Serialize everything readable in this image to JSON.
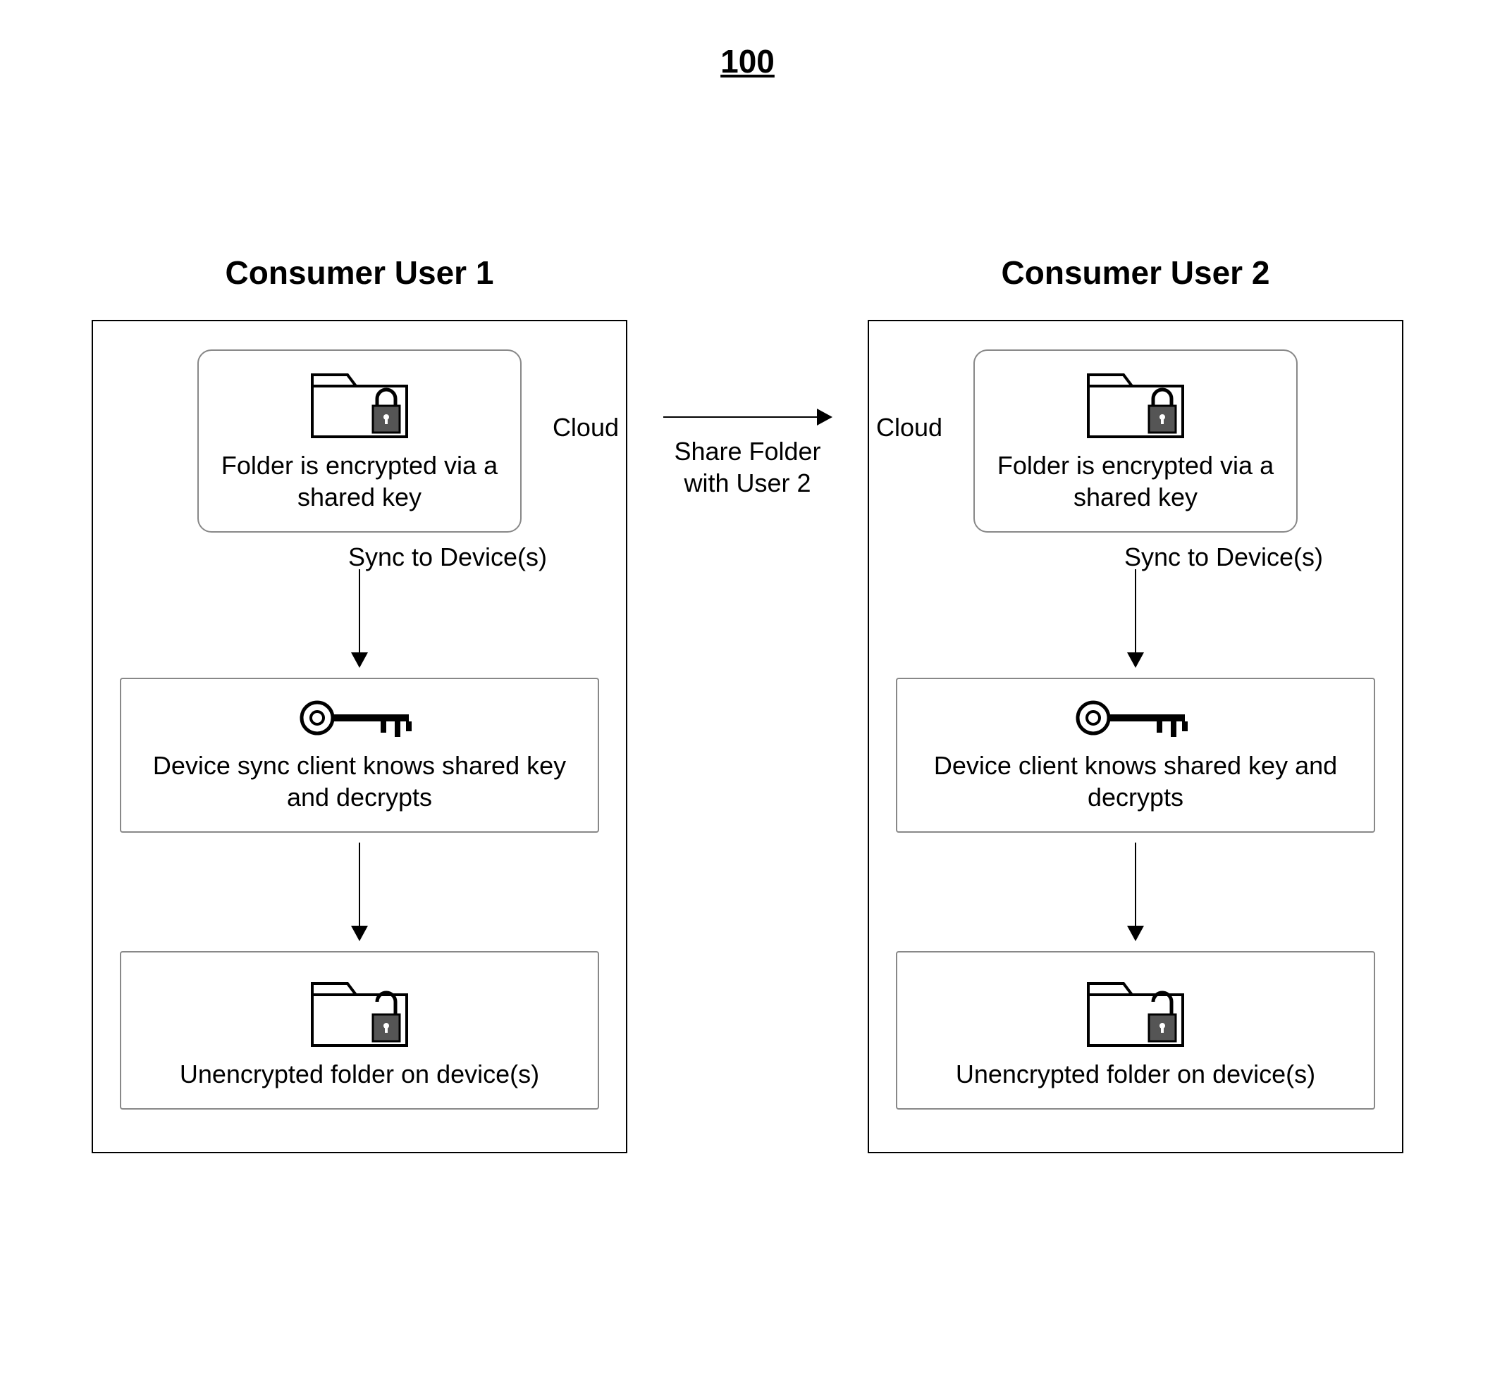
{
  "figure_number": "100",
  "users": {
    "u1": {
      "title": "Consumer User 1",
      "cloudLabel": "Cloud",
      "cloudCard": "Folder is encrypted via a shared key",
      "syncLabel": "Sync to Device(s)",
      "deviceCard": "Device sync client knows shared key and decrypts",
      "resultCard": "Unencrypted folder on device(s)"
    },
    "u2": {
      "title": "Consumer User 2",
      "cloudLabel": "Cloud",
      "cloudCard": "Folder is encrypted via a shared key",
      "syncLabel": "Sync to Device(s)",
      "deviceCard": "Device client knows shared key and decrypts",
      "resultCard": "Unencrypted folder on device(s)"
    }
  },
  "share": {
    "label": "Share Folder with User 2"
  }
}
